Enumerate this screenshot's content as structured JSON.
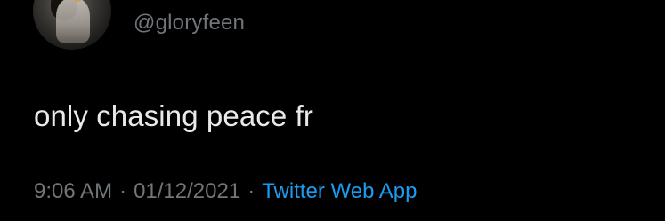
{
  "tweet": {
    "avatar_icon": "profile-photo-avatar",
    "handle": "@gloryfeen",
    "text": "only chasing peace fr",
    "time": "9:06 AM",
    "separator": "·",
    "date": "01/12/2021",
    "source": "Twitter Web App"
  },
  "colors": {
    "background": "#000000",
    "text_primary": "#e7e9ea",
    "text_secondary": "#71767b",
    "link": "#1d9bf0"
  }
}
